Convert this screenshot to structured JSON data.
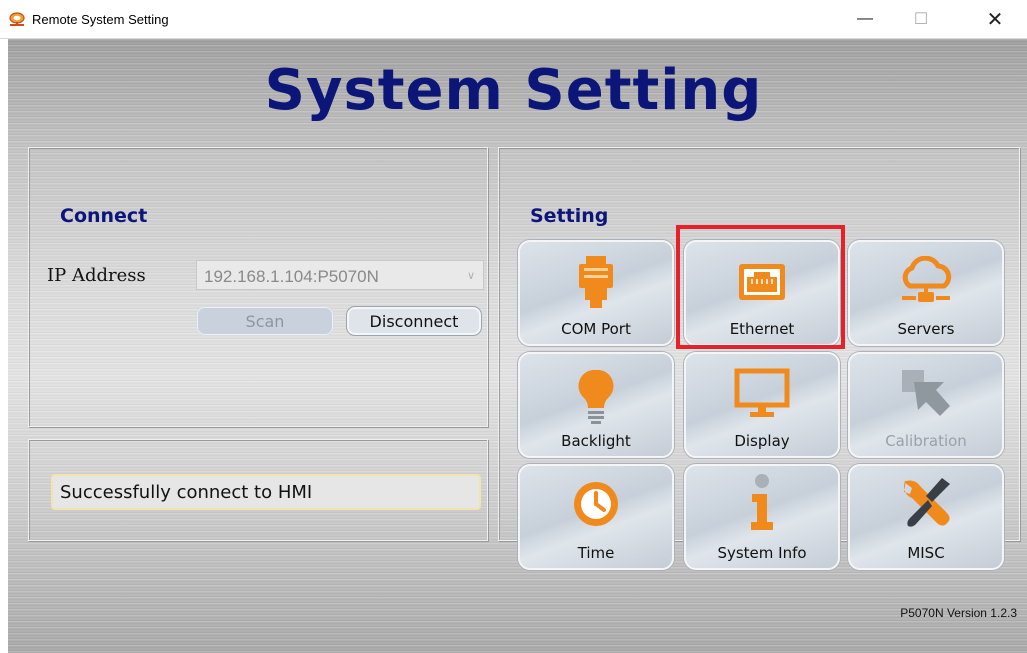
{
  "window": {
    "title": "Remote System Setting",
    "controls": {
      "minimize": "—",
      "maximize": "☐",
      "close": "✕"
    }
  },
  "header": {
    "title": "System Setting"
  },
  "connect": {
    "title": "Connect",
    "ip_label": "IP Address",
    "ip_value": "192.168.1.104:P5070N",
    "scan_label": "Scan",
    "disconnect_label": "Disconnect"
  },
  "status": {
    "message": "Successfully connect to HMI"
  },
  "setting": {
    "title": "Setting",
    "tiles": [
      {
        "label": "COM Port",
        "icon": "com-port-icon",
        "enabled": true
      },
      {
        "label": "Ethernet",
        "icon": "ethernet-icon",
        "enabled": true
      },
      {
        "label": "Servers",
        "icon": "servers-icon",
        "enabled": true
      },
      {
        "label": "Backlight",
        "icon": "backlight-icon",
        "enabled": true
      },
      {
        "label": "Display",
        "icon": "display-icon",
        "enabled": true
      },
      {
        "label": "Calibration",
        "icon": "calibration-icon",
        "enabled": false
      },
      {
        "label": "Time",
        "icon": "time-icon",
        "enabled": true
      },
      {
        "label": "System Info",
        "icon": "system-info-icon",
        "enabled": true
      },
      {
        "label": "MISC",
        "icon": "misc-icon",
        "enabled": true
      }
    ]
  },
  "footer": {
    "version": "P5070N Version 1.2.3"
  },
  "colors": {
    "title_blue": "#0c1578",
    "accent_orange": "#f08a1c",
    "highlight_red": "#e8202a"
  }
}
